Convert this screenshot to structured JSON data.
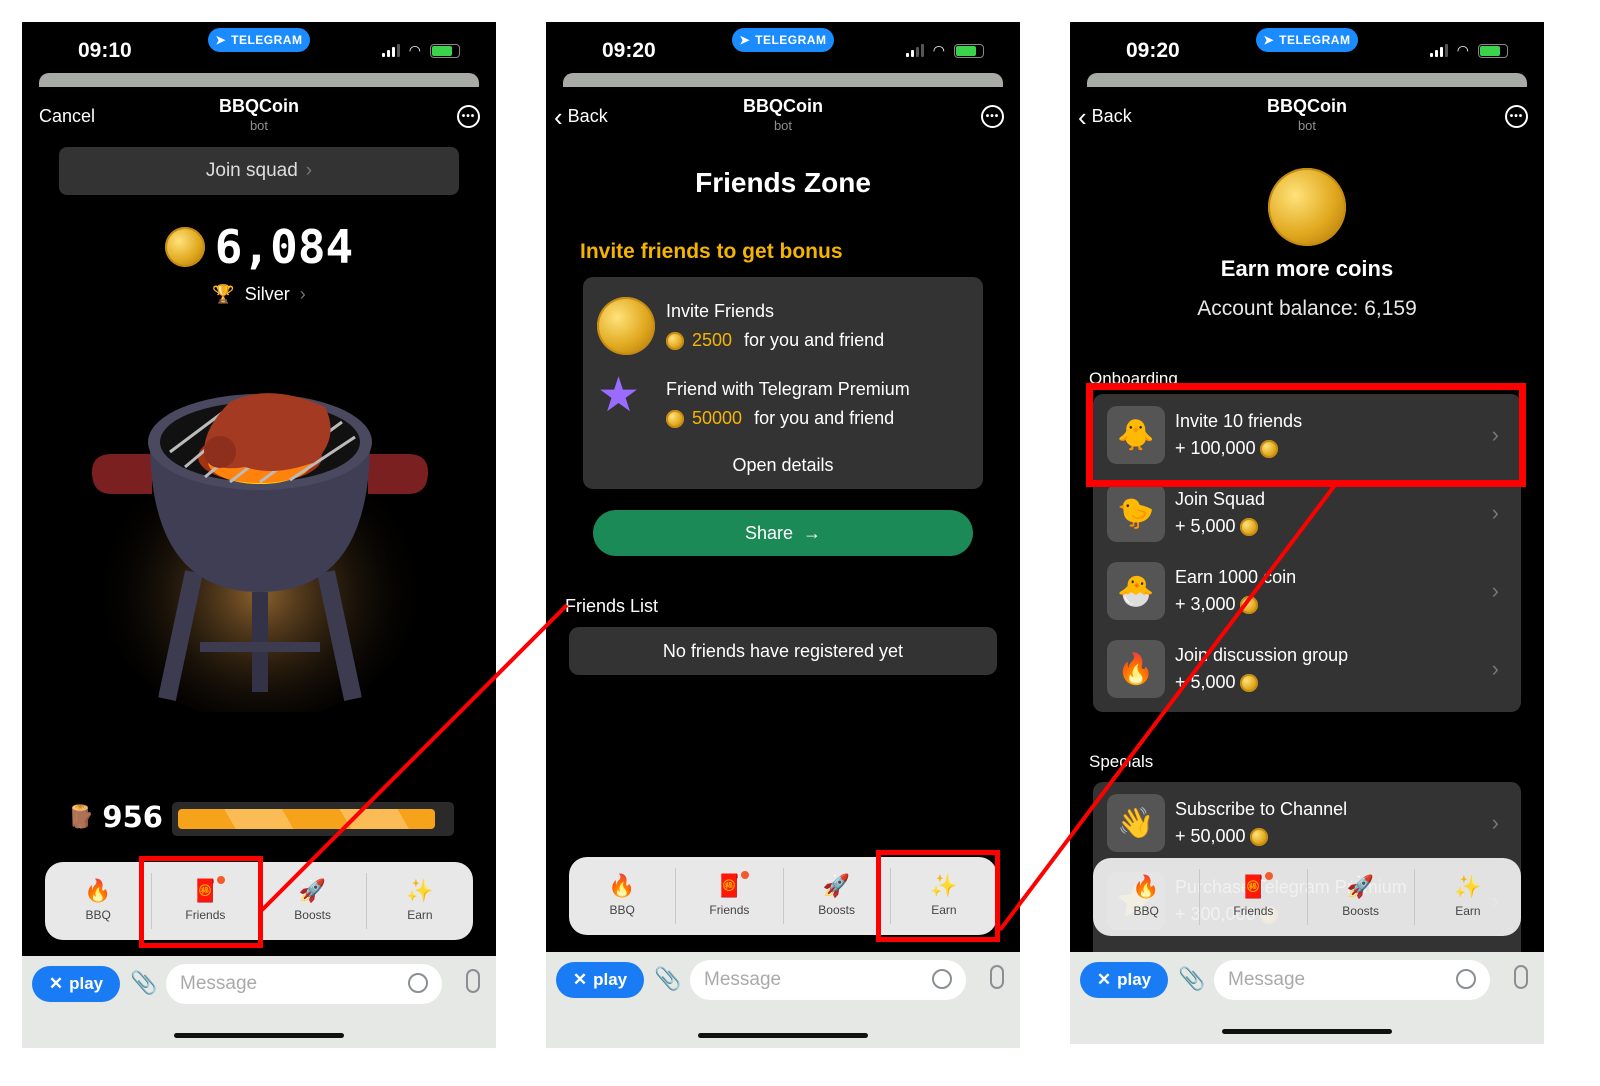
{
  "common": {
    "telegram_pill": "TELEGRAM",
    "app_title": "BBQCoin",
    "app_subtitle": "bot",
    "input_placeholder": "Message",
    "play_label": "play",
    "tabs": [
      {
        "label": "BBQ",
        "icon": "🔥"
      },
      {
        "label": "Friends",
        "icon": "🧧"
      },
      {
        "label": "Boosts",
        "icon": "🚀"
      },
      {
        "label": "Earn",
        "icon": "✨"
      }
    ],
    "colors": {
      "accent_blue": "#1a7cf5",
      "gold": "#f5b400",
      "share_green": "#1c8a56",
      "annotation_red": "#ff0000",
      "energy_orange": "#f7a21b"
    }
  },
  "screen1": {
    "time": "09:10",
    "nav_left": "Cancel",
    "join_squad": "Join squad",
    "balance": "6,084",
    "league": "Silver",
    "energy_value": "956",
    "energy_fill_percent": 95
  },
  "screen2": {
    "time": "09:20",
    "nav_left": "Back",
    "title": "Friends Zone",
    "subtitle": "Invite friends to get bonus",
    "invite": {
      "title": "Invite Friends",
      "amount": "2500",
      "suffix": "for you and friend"
    },
    "premium": {
      "title": "Friend with Telegram Premium",
      "amount": "50000",
      "suffix": "for you and friend"
    },
    "open_details": "Open details",
    "share": "Share",
    "friends_list_title": "Friends List",
    "friends_empty": "No friends have registered yet"
  },
  "screen3": {
    "time": "09:20",
    "nav_left": "Back",
    "title": "Earn more coins",
    "balance_label": "Account balance: 6,159",
    "onboarding_title": "Onboarding",
    "onboarding": [
      {
        "icon": "🐥",
        "title": "Invite 10 friends",
        "reward": "+ 100,000"
      },
      {
        "icon": "🐤",
        "title": "Join Squad",
        "reward": "+ 5,000"
      },
      {
        "icon": "🐣",
        "title": "Earn 1000 coin",
        "reward": "+ 3,000"
      },
      {
        "icon": "🔥",
        "title": "Join discussion group",
        "reward": "+ 5,000"
      }
    ],
    "specials_title": "Specials",
    "specials": [
      {
        "icon": "👋",
        "title": "Subscribe to Channel",
        "reward": "+ 50,000"
      },
      {
        "icon": "⭐",
        "title": "Purchase Telegram Premium",
        "reward": "+ 300,000"
      }
    ]
  }
}
